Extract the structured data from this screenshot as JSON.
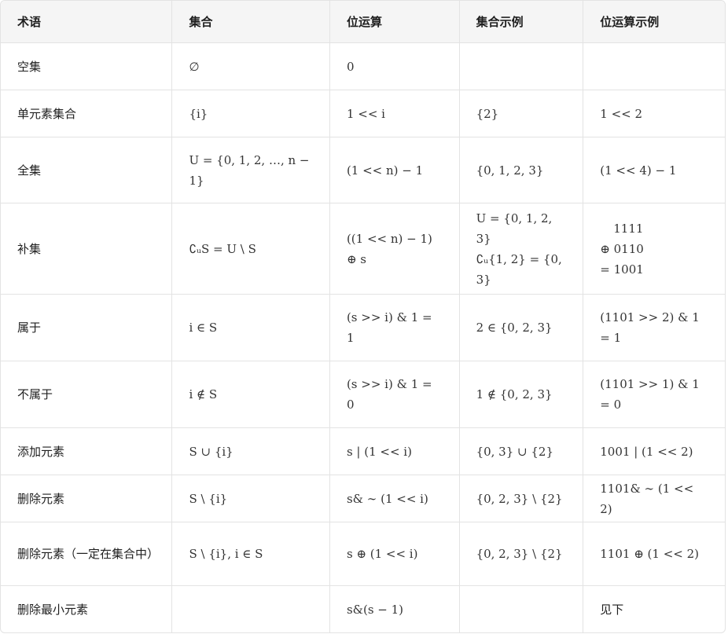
{
  "headers": [
    "术语",
    "集合",
    "位运算",
    "集合示例",
    "位运算示例"
  ],
  "rows": [
    {
      "term": "空集",
      "set": "∅",
      "bit": "0",
      "set_ex": "",
      "bit_ex": ""
    },
    {
      "term": "单元素集合",
      "set": "{i}",
      "bit": "1 << i",
      "set_ex": "{2}",
      "bit_ex": "1 << 2"
    },
    {
      "term": "全集",
      "set": "U = {0, 1, 2, …, n − 1}",
      "bit": "(1 << n) − 1",
      "set_ex": "{0, 1, 2, 3}",
      "bit_ex": "(1 << 4) − 1"
    },
    {
      "term": "补集",
      "set": "∁ᵤS = U \\ S",
      "bit": "((1 << n) − 1) ⊕ s",
      "set_ex_lines": [
        "U = {0, 1, 2, 3}",
        "∁ᵤ{1, 2} = {0, 3}"
      ],
      "bit_ex_lines": [
        "1111",
        "⊕ 0110",
        "= 1001"
      ]
    },
    {
      "term": "属于",
      "set": "i ∈ S",
      "bit": "(s >> i) & 1 = 1",
      "set_ex": "2 ∈ {0, 2, 3}",
      "bit_ex": "(1101 >> 2) & 1 = 1"
    },
    {
      "term": "不属于",
      "set": "i ∉ S",
      "bit": "(s >> i) & 1 = 0",
      "set_ex": "1 ∉ {0, 2, 3}",
      "bit_ex": "(1101 >> 1) & 1 = 0"
    },
    {
      "term": "添加元素",
      "set": "S ∪ {i}",
      "bit": "s | (1 << i)",
      "set_ex": "{0, 3} ∪ {2}",
      "bit_ex": "1001 | (1 << 2)"
    },
    {
      "term": "删除元素",
      "set": "S \\ {i}",
      "bit": "s& ∼ (1 << i)",
      "set_ex": "{0, 2, 3} \\ {2}",
      "bit_ex": "1101& ∼ (1 << 2)"
    },
    {
      "term": "删除元素（一定在集合中）",
      "set": "S \\ {i}, i ∈ S",
      "bit": "s ⊕ (1 << i)",
      "set_ex": "{0, 2, 3} \\ {2}",
      "bit_ex": "1101 ⊕ (1 << 2)"
    },
    {
      "term": "删除最小元素",
      "set": "",
      "bit": "s&(s − 1)",
      "set_ex": "",
      "bit_ex": "见下"
    }
  ]
}
